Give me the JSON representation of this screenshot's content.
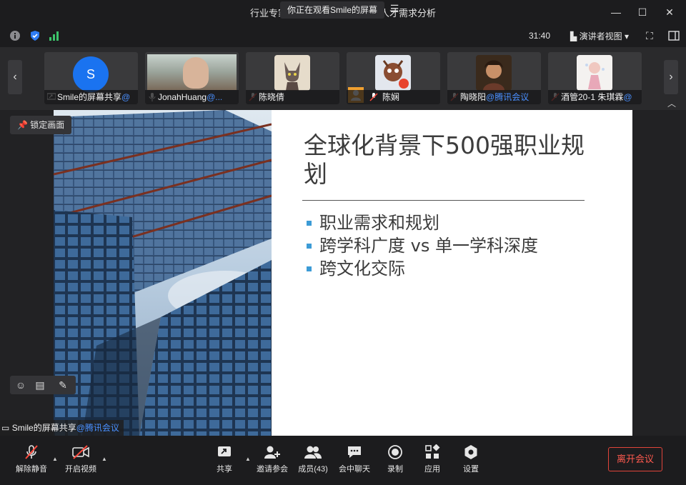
{
  "window": {
    "title": "行业专家讲座：走进跨国企业的人才需求分析",
    "watch_banner": "你正在观看Smile的屏幕",
    "minimize": "—",
    "maximize": "☐",
    "close": "✕"
  },
  "toolbar2": {
    "timer": "31:40",
    "view_mode": "演讲者视图",
    "view_caret": "▾"
  },
  "participants": [
    {
      "name": "Smile的屏幕共享",
      "org": "@",
      "avatar_letter": "S"
    },
    {
      "name": "JonahHuang",
      "org": "@..."
    },
    {
      "name": "陈晓倩",
      "org": ""
    },
    {
      "name": "陈娴",
      "org": ""
    },
    {
      "name": "陶晓阳",
      "org": "@腾讯会议"
    },
    {
      "name": "酒管20-1 朱琪霖",
      "org": "@"
    }
  ],
  "stage": {
    "lock_label": "锁定画面",
    "share_label": "Smile的屏幕共享",
    "share_org": "@腾讯会议"
  },
  "slide": {
    "title": "全球化背景下500强职业规划",
    "bullets": [
      "职业需求和规划",
      "跨学科广度 vs 单一学科深度",
      "跨文化交际"
    ]
  },
  "bottombar": {
    "unmute": "解除静音",
    "start_video": "开启视频",
    "share": "共享",
    "invite": "邀请参会",
    "members": "成员(43)",
    "chat": "会中聊天",
    "record": "录制",
    "apps": "应用",
    "settings": "设置",
    "leave": "离开会议"
  },
  "colors": {
    "accent_blue": "#4a90ff",
    "leave_red": "#e0443a",
    "bullet_blue": "#3c9bd6",
    "signal_green": "#3cc36a"
  }
}
